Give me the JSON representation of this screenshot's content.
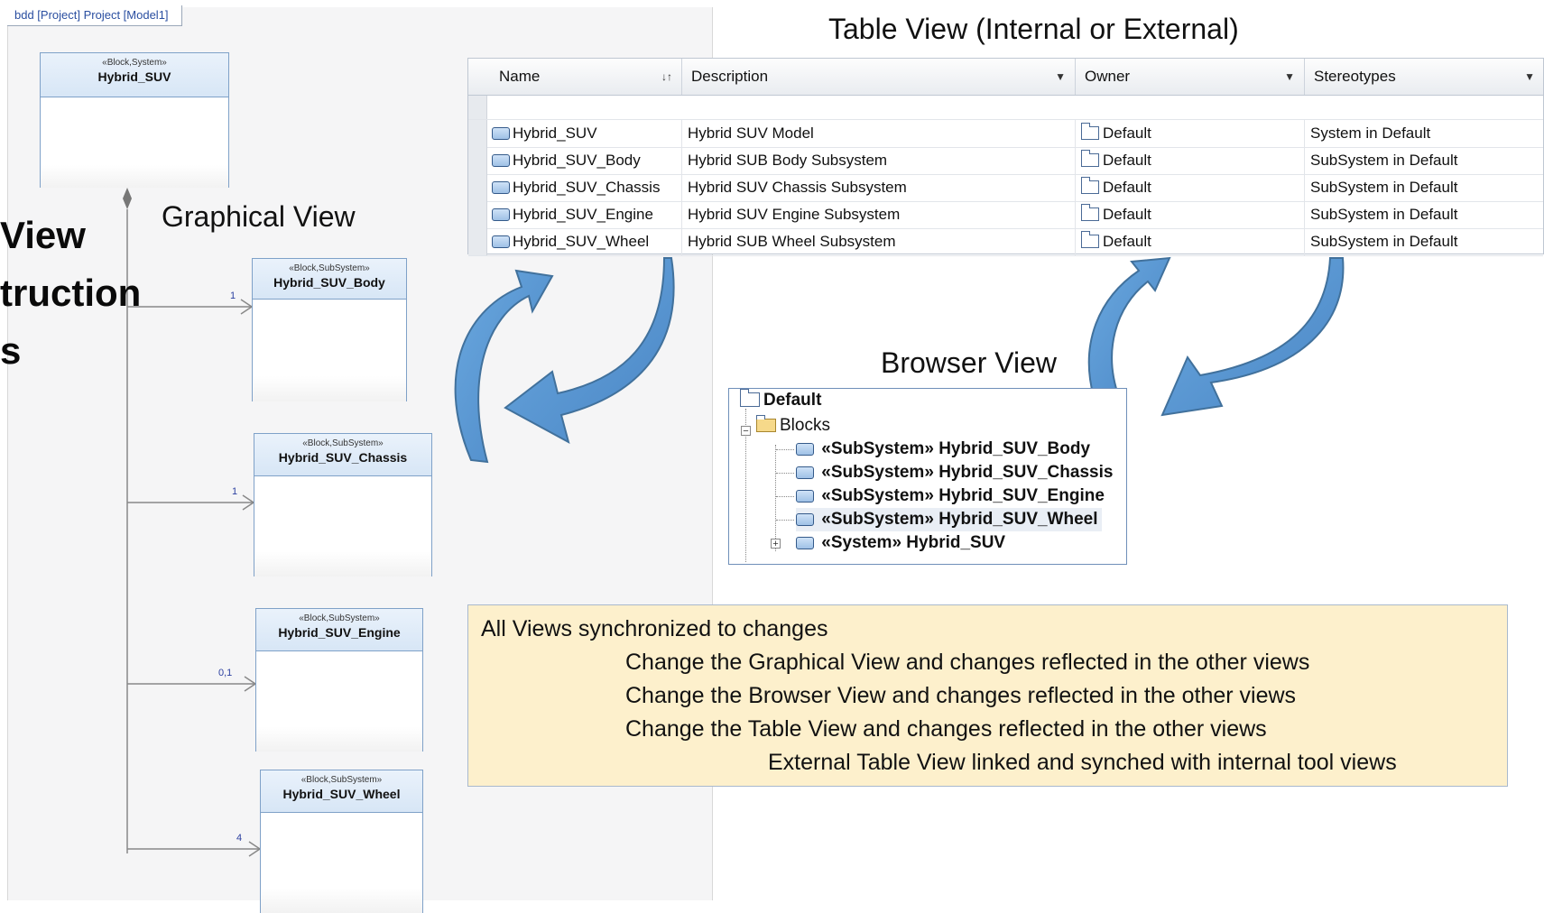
{
  "diagram_tab": "bdd [Project] Project [Model1]",
  "left_fragment": {
    "line1": "View",
    "line2": "truction",
    "line3": "s"
  },
  "graphical_view": {
    "title": "Graphical View",
    "root_block": {
      "stereotype": "«Block,System»",
      "name": "Hybrid_SUV"
    },
    "blocks": [
      {
        "stereotype": "«Block,SubSystem»",
        "name": "Hybrid_SUV_Body",
        "multiplicity": "1"
      },
      {
        "stereotype": "«Block,SubSystem»",
        "name": "Hybrid_SUV_Chassis",
        "multiplicity": "1"
      },
      {
        "stereotype": "«Block,SubSystem»",
        "name": "Hybrid_SUV_Engine",
        "multiplicity": "0,1"
      },
      {
        "stereotype": "«Block,SubSystem»",
        "name": "Hybrid_SUV_Wheel",
        "multiplicity": "4"
      }
    ]
  },
  "table_view": {
    "title": "Table View (Internal or External)",
    "columns": [
      "Name",
      "Description",
      "Owner",
      "Stereotypes"
    ],
    "sort_indicator": "↓↑",
    "dropdown_icon": "▼",
    "rows": [
      {
        "name": "Hybrid_SUV",
        "description": "Hybrid SUV Model",
        "owner": "Default",
        "stereotypes": "System in Default"
      },
      {
        "name": "Hybrid_SUV_Body",
        "description": "Hybrid SUB Body Subsystem",
        "owner": "Default",
        "stereotypes": "SubSystem in Default"
      },
      {
        "name": "Hybrid_SUV_Chassis",
        "description": "Hybrid SUV Chassis Subsystem",
        "owner": "Default",
        "stereotypes": "SubSystem in Default"
      },
      {
        "name": "Hybrid_SUV_Engine",
        "description": "Hybrid SUV Engine Subsystem",
        "owner": "Default",
        "stereotypes": "SubSystem in Default"
      },
      {
        "name": "Hybrid_SUV_Wheel",
        "description": "Hybrid SUB Wheel Subsystem",
        "owner": "Default",
        "stereotypes": "SubSystem in Default"
      }
    ]
  },
  "browser_view": {
    "title": "Browser View",
    "root": "Default",
    "folder": "Blocks",
    "items": [
      {
        "stereotype": "«SubSystem»",
        "name": "Hybrid_SUV_Body"
      },
      {
        "stereotype": "«SubSystem»",
        "name": "Hybrid_SUV_Chassis"
      },
      {
        "stereotype": "«SubSystem»",
        "name": "Hybrid_SUV_Engine"
      },
      {
        "stereotype": "«SubSystem»",
        "name": "Hybrid_SUV_Wheel"
      },
      {
        "stereotype": "«System»",
        "name": "Hybrid_SUV"
      }
    ],
    "expand_glyph": "+",
    "collapse_glyph": "−"
  },
  "notes": {
    "line1": "All Views synchronized to changes",
    "line2": "Change the Graphical View and changes reflected in the other views",
    "line3": "Change the Browser View and changes reflected in the other views",
    "line4": "Change the Table View and changes reflected in the other views",
    "line5": "External Table View linked and synched with internal tool views"
  },
  "colors": {
    "arrow": "#5b9bd5",
    "arrow_edge": "#41719c",
    "note_bg": "#fdf0cc",
    "block_border": "#7fa1c8"
  }
}
